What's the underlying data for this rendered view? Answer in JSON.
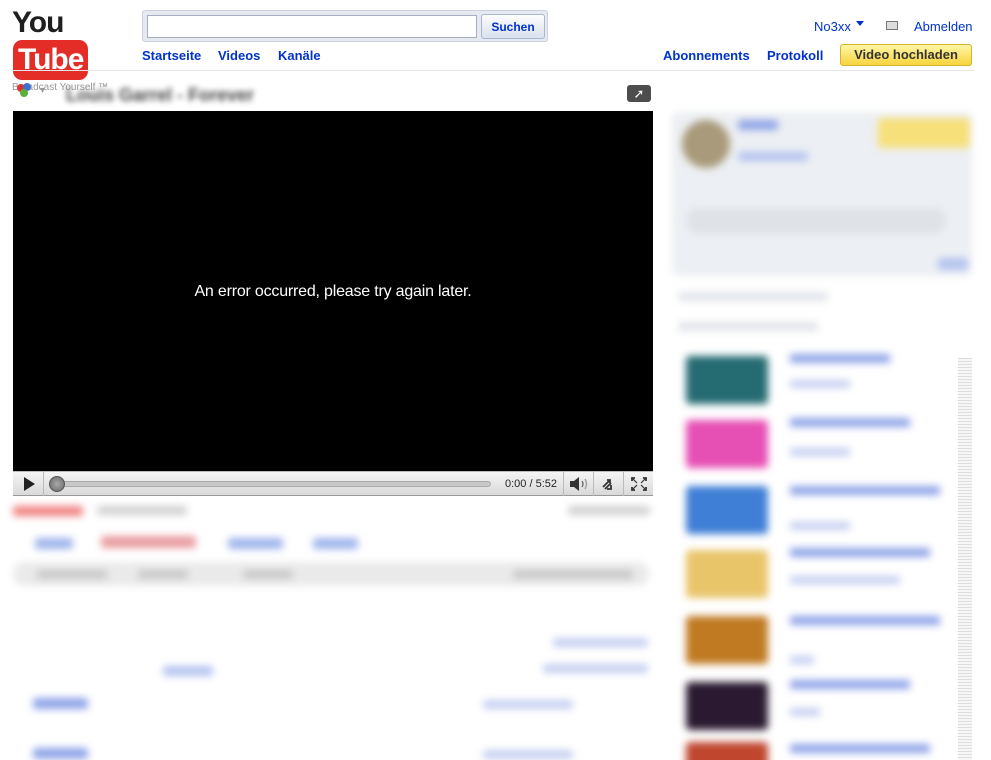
{
  "header": {
    "logo_you": "You",
    "logo_tube": "Tube",
    "logo_tagline": "Broadcast Yourself ™",
    "search_placeholder": "",
    "search_button": "Suchen",
    "nav": [
      "Startseite",
      "Videos",
      "Kanäle"
    ],
    "user_name": "No3xx",
    "logout": "Abmelden",
    "subscriptions": "Abonnements",
    "history": "Protokoll",
    "upload": "Video hochladen"
  },
  "video": {
    "title": "Louis Garrel - Forever",
    "error_message": "An error occurred, please try again later.",
    "time": "0:00 / 5:52",
    "progress_fraction": 0.0
  },
  "icons": {
    "share": "share-icon",
    "popout": "popout-icon",
    "play": "play-icon",
    "volume": "volume-icon",
    "resize": "resize-icon",
    "fullscreen": "fullscreen-icon",
    "mail": "mail-icon"
  },
  "colors": {
    "link": "#0033cc",
    "upload_button": "#f7d43d",
    "logo_red": "#e52d27",
    "player_bg": "#000000"
  }
}
